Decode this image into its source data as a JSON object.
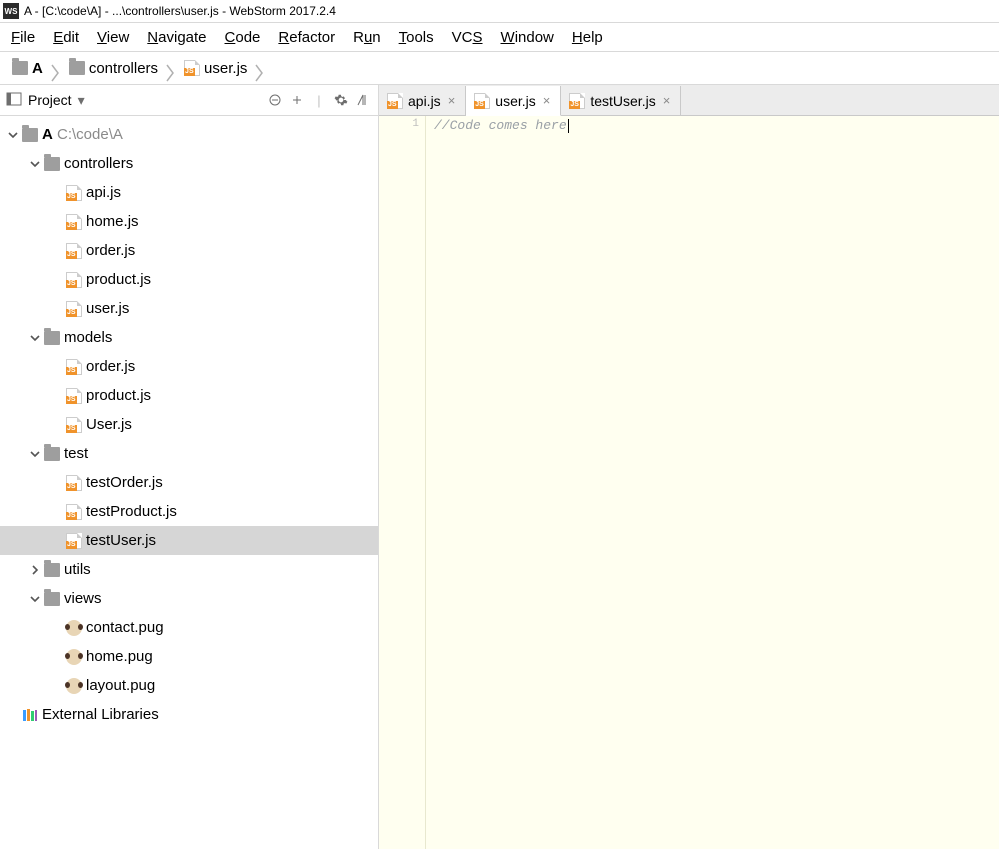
{
  "window": {
    "title": "A - [C:\\code\\A] - ...\\controllers\\user.js - WebStorm 2017.2.4"
  },
  "menubar": [
    {
      "label": "File",
      "u": 0
    },
    {
      "label": "Edit",
      "u": 0
    },
    {
      "label": "View",
      "u": 0
    },
    {
      "label": "Navigate",
      "u": 0
    },
    {
      "label": "Code",
      "u": 0
    },
    {
      "label": "Refactor",
      "u": 0
    },
    {
      "label": "Run",
      "u": 1
    },
    {
      "label": "Tools",
      "u": 0
    },
    {
      "label": "VCS",
      "u": 2
    },
    {
      "label": "Window",
      "u": 0
    },
    {
      "label": "Help",
      "u": 0
    }
  ],
  "breadcrumbs": [
    {
      "icon": "folder",
      "label": "A",
      "bold": true
    },
    {
      "icon": "folder",
      "label": "controllers"
    },
    {
      "icon": "js",
      "label": "user.js"
    }
  ],
  "sidebar": {
    "title": "Project"
  },
  "tree": {
    "root": {
      "label": "A",
      "path": "C:\\code\\A"
    },
    "folders": [
      {
        "name": "controllers",
        "open": true,
        "files": [
          "api.js",
          "home.js",
          "order.js",
          "product.js",
          "user.js"
        ],
        "icon": "js"
      },
      {
        "name": "models",
        "open": true,
        "files": [
          "order.js",
          "product.js",
          "User.js"
        ],
        "icon": "js"
      },
      {
        "name": "test",
        "open": true,
        "files": [
          "testOrder.js",
          "testProduct.js",
          "testUser.js"
        ],
        "icon": "js",
        "selected": "testUser.js"
      },
      {
        "name": "utils",
        "open": false,
        "files": []
      },
      {
        "name": "views",
        "open": true,
        "files": [
          "contact.pug",
          "home.pug",
          "layout.pug"
        ],
        "icon": "pug"
      }
    ],
    "external": "External Libraries"
  },
  "tabs": [
    {
      "label": "api.js",
      "active": false
    },
    {
      "label": "user.js",
      "active": true
    },
    {
      "label": "testUser.js",
      "active": false
    }
  ],
  "editor": {
    "line_number": "1",
    "line1": "//Code comes here"
  }
}
